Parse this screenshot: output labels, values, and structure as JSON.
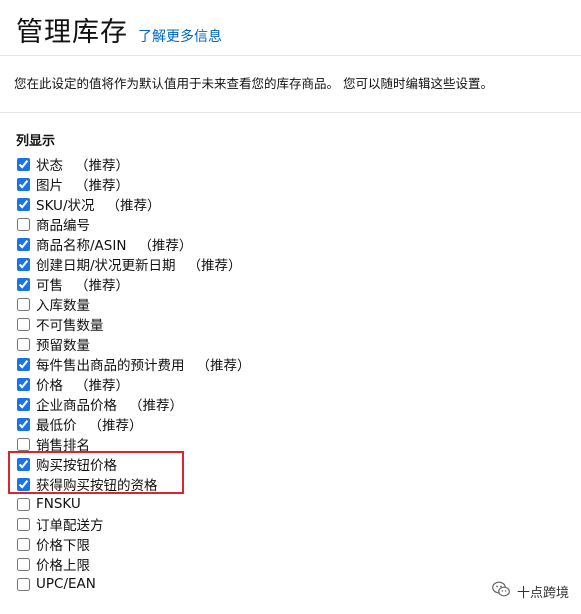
{
  "header": {
    "title": "管理库存",
    "learn_more": "了解更多信息"
  },
  "description": "您在此设定的值将作为默认值用于未来查看您的库存商品。 您可以随时编辑这些设置。",
  "columns_section": {
    "heading": "列显示",
    "items": [
      {
        "label": "状态",
        "note": "（推荐）",
        "checked": true
      },
      {
        "label": "图片",
        "note": "（推荐）",
        "checked": true
      },
      {
        "label": "SKU/状况",
        "note": "（推荐）",
        "checked": true
      },
      {
        "label": "商品编号",
        "note": "",
        "checked": false
      },
      {
        "label": "商品名称/ASIN",
        "note": "（推荐）",
        "checked": true
      },
      {
        "label": "创建日期/状况更新日期",
        "note": "（推荐）",
        "checked": true
      },
      {
        "label": "可售",
        "note": "（推荐）",
        "checked": true
      },
      {
        "label": "入库数量",
        "note": "",
        "checked": false
      },
      {
        "label": "不可售数量",
        "note": "",
        "checked": false
      },
      {
        "label": "预留数量",
        "note": "",
        "checked": false
      },
      {
        "label": "每件售出商品的预计费用",
        "note": "（推荐）",
        "checked": true
      },
      {
        "label": "价格",
        "note": "（推荐）",
        "checked": true
      },
      {
        "label": "企业商品价格",
        "note": "（推荐）",
        "checked": true
      },
      {
        "label": "最低价",
        "note": "（推荐）",
        "checked": true
      },
      {
        "label": "销售排名",
        "note": "",
        "checked": false
      },
      {
        "label": "购买按钮价格",
        "note": "",
        "checked": true
      },
      {
        "label": "获得购买按钮的资格",
        "note": "",
        "checked": true
      },
      {
        "label": "FNSKU",
        "note": "",
        "checked": false
      },
      {
        "label": "订单配送方",
        "note": "",
        "checked": false
      },
      {
        "label": "价格下限",
        "note": "",
        "checked": false
      },
      {
        "label": "价格上限",
        "note": "",
        "checked": false
      },
      {
        "label": "UPC/EAN",
        "note": "",
        "checked": false
      }
    ]
  },
  "annotation": {
    "color": "#d9252b"
  },
  "watermark": {
    "text": "十点跨境",
    "icon": "wechat-icon"
  },
  "colors": {
    "link": "#0066c0",
    "checkbox": "#1a73e8"
  }
}
